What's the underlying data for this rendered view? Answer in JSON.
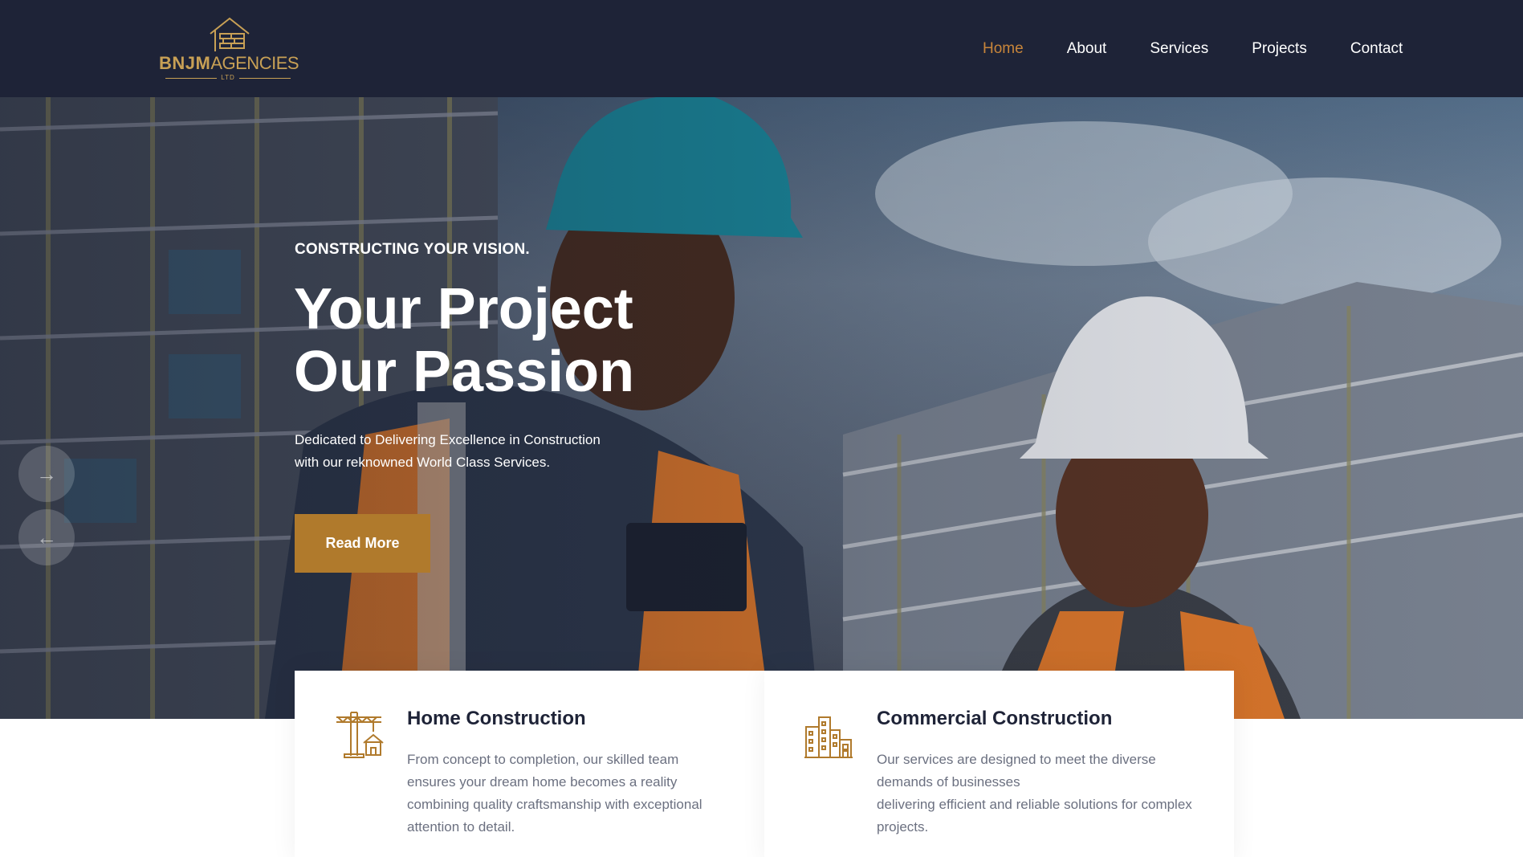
{
  "brand": {
    "logo_primary": "BNJM",
    "logo_secondary": "AGENCIES",
    "logo_suffix": "LTD",
    "logo_icon": "house-bricks-icon"
  },
  "nav": {
    "items": [
      {
        "label": "Home",
        "active": true
      },
      {
        "label": "About",
        "active": false
      },
      {
        "label": "Services",
        "active": false
      },
      {
        "label": "Projects",
        "active": false
      },
      {
        "label": "Contact",
        "active": false
      }
    ]
  },
  "hero": {
    "eyebrow": "CONSTRUCTING YOUR VISION.",
    "headline_line1": "Your Project",
    "headline_line2": "Our Passion",
    "subtext_line1": "Dedicated to Delivering Excellence in Construction",
    "subtext_line2": "with our reknowned World Class Services.",
    "cta_label": "Read More",
    "next_icon": "arrow-right-icon",
    "prev_icon": "arrow-left-icon"
  },
  "cards": [
    {
      "title": "Home Construction",
      "icon": "crane-house-icon",
      "lines": [
        "From concept to completion, our skilled team",
        "ensures your dream home becomes a reality",
        "combining quality craftsmanship with exceptional",
        "attention to detail."
      ]
    },
    {
      "title": "Commercial Construction",
      "icon": "commercial-buildings-icon",
      "lines": [
        "Our services are designed to meet the diverse",
        "demands of businesses",
        "delivering efficient and reliable solutions for complex",
        "projects."
      ]
    }
  ],
  "colors": {
    "header_bg": "#1e2337",
    "accent": "#b07a2c",
    "nav_active": "#c8853a",
    "logo_gold": "#c8a055",
    "white": "#ffffff"
  }
}
